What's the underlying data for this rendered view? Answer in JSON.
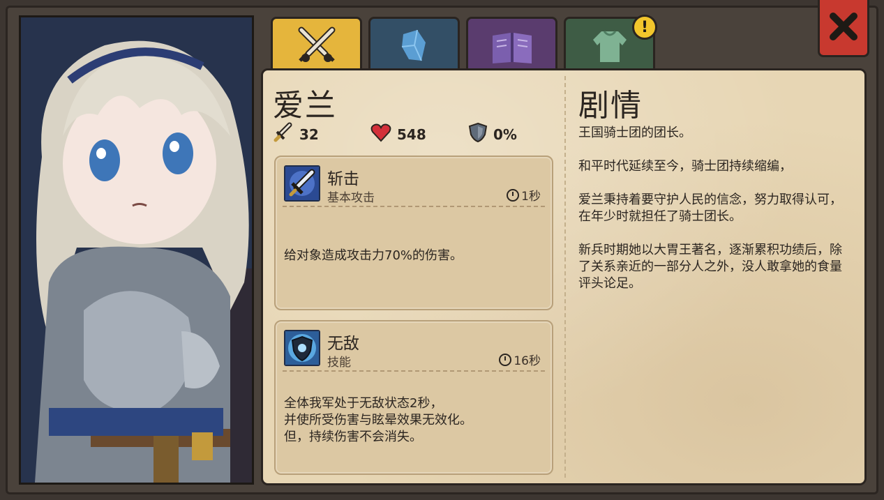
{
  "character": {
    "name": "爱兰",
    "attack": "32",
    "hp": "548",
    "defense": "0%"
  },
  "tabs": [
    {
      "icon": "crossed-swords-icon",
      "active": true
    },
    {
      "icon": "crystal-icon",
      "active": false
    },
    {
      "icon": "book-icon",
      "active": false
    },
    {
      "icon": "armor-icon",
      "active": false,
      "badge": "!"
    }
  ],
  "skills": [
    {
      "name": "斩击",
      "type": "基本攻击",
      "cooldown": "1秒",
      "description": "给对象造成攻击力70%的伤害。"
    },
    {
      "name": "无敌",
      "type": "技能",
      "cooldown": "16秒",
      "description_lines": [
        "全体我军处于无敌状态2秒，",
        "并使所受伤害与眩晕效果无效化。",
        "但，持续伤害不会消失。"
      ]
    }
  ],
  "story": {
    "title": "剧情",
    "paragraphs": [
      "王国骑士团的团长。",
      "和平时代延续至今，骑士团持续缩编，",
      "爱兰秉持着要守护人民的信念，努力取得认可，在年少时就担任了骑士团长。",
      "新兵时期她以大胃王著名，逐渐累积功绩后，除了关系亲近的一部分人之外，没人敢拿她的食量评头论足。"
    ]
  },
  "colors": {
    "parchment": "#e7d6b4",
    "active_tab": "#e5b53c",
    "close_button": "#c8392f",
    "hp_heart": "#d3303a"
  }
}
